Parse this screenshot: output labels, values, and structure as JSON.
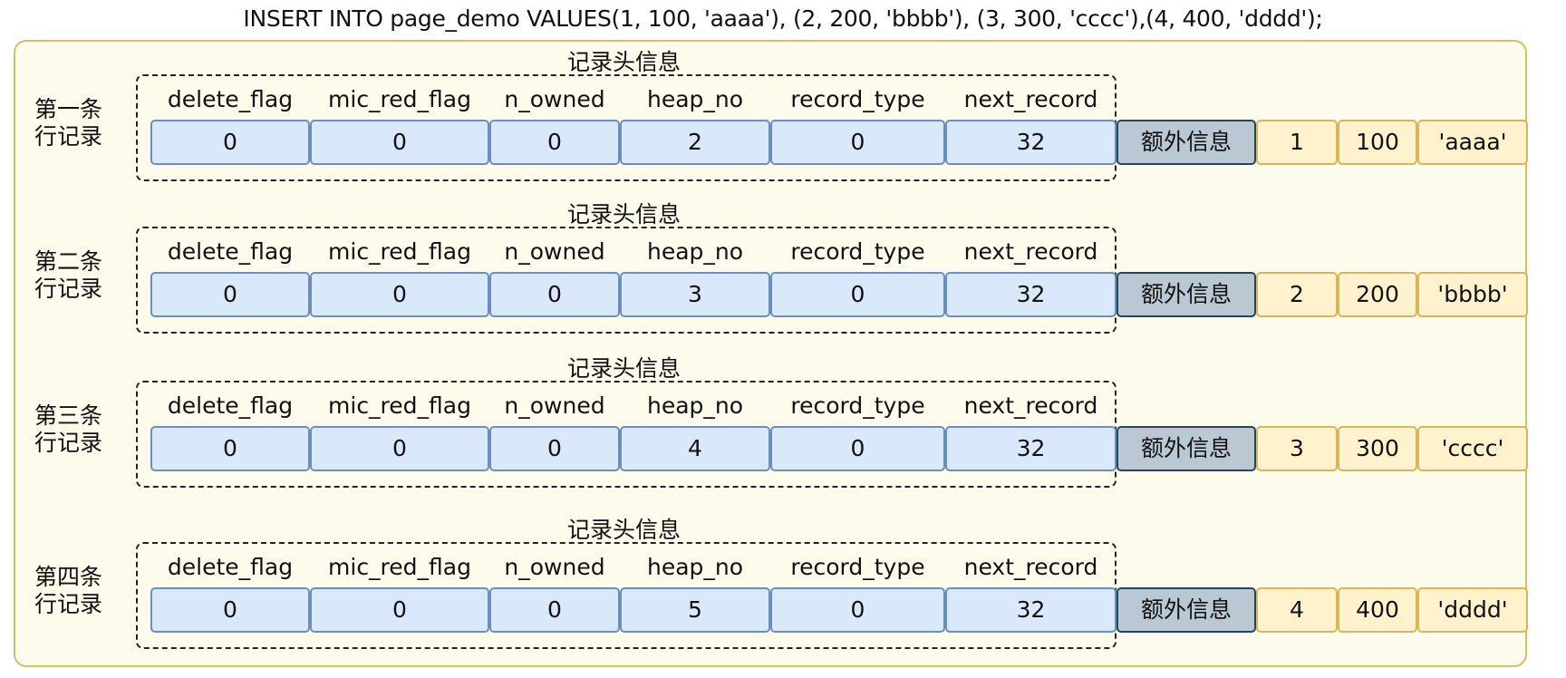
{
  "sql": "INSERT INTO page_demo VALUES(1, 100, 'aaaa'), (2, 200, 'bbbb'), (3, 300, 'cccc'),(4, 400, 'dddd');",
  "header_title": "记录头信息",
  "extra_label": "额外信息",
  "fields": [
    "delete_flag",
    "mic_red_flag",
    "n_owned",
    "heap_no",
    "record_type",
    "next_record"
  ],
  "records": [
    {
      "label_line1": "第一条",
      "label_line2": "行记录",
      "header_values": [
        "0",
        "0",
        "0",
        "2",
        "0",
        "32"
      ],
      "data": [
        "1",
        "100",
        "'aaaa'"
      ]
    },
    {
      "label_line1": "第二条",
      "label_line2": "行记录",
      "header_values": [
        "0",
        "0",
        "0",
        "3",
        "0",
        "32"
      ],
      "data": [
        "2",
        "200",
        "'bbbb'"
      ]
    },
    {
      "label_line1": "第三条",
      "label_line2": "行记录",
      "header_values": [
        "0",
        "0",
        "0",
        "4",
        "0",
        "32"
      ],
      "data": [
        "3",
        "300",
        "'cccc'"
      ]
    },
    {
      "label_line1": "第四条",
      "label_line2": "行记录",
      "header_values": [
        "0",
        "0",
        "0",
        "5",
        "0",
        "32"
      ],
      "data": [
        "4",
        "400",
        "'dddd'"
      ]
    }
  ],
  "colors": {
    "panel_fill": "#fdfbeb",
    "panel_border": "#d9bc63",
    "header_cell_fill": "#dae8fc",
    "header_cell_border": "#6c8ebf",
    "extra_fill": "#bac8d3",
    "extra_border": "#23445d",
    "value_fill": "#fff2cc",
    "value_border": "#d6b656"
  }
}
